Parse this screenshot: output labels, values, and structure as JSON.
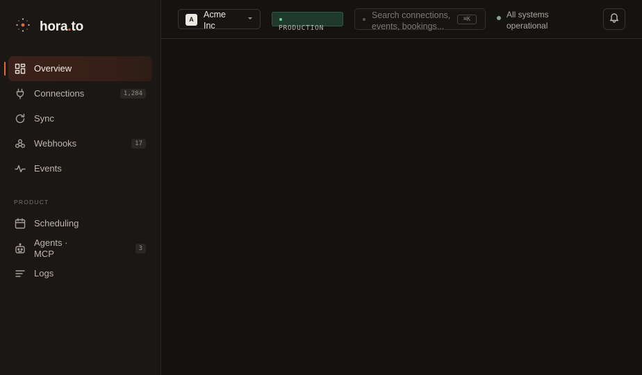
{
  "brand": {
    "name_prefix": "hora",
    "name_dot": ".",
    "name_suffix": "to",
    "accent": "#e0683f",
    "icon": "constellation-logo-icon"
  },
  "sidebar": {
    "main_items": [
      {
        "label": "Overview",
        "icon": "grid-icon",
        "active": true,
        "badge": ""
      },
      {
        "label": "Connections",
        "icon": "plug-icon",
        "active": false,
        "badge": "1,284"
      },
      {
        "label": "Sync",
        "icon": "refresh-icon",
        "active": false,
        "badge": ""
      },
      {
        "label": "Webhooks",
        "icon": "link-icon",
        "active": false,
        "badge": "17"
      },
      {
        "label": "Events",
        "icon": "pulse-icon",
        "active": false,
        "badge": ""
      }
    ],
    "section_label": "PRODUCT",
    "product_items": [
      {
        "label": "Scheduling",
        "icon": "calendar-icon",
        "badge": ""
      },
      {
        "label": "Agents · MCP",
        "icon": "robot-icon",
        "badge": "3"
      },
      {
        "label": "Logs",
        "icon": "lines-icon",
        "badge": ""
      }
    ]
  },
  "topbar": {
    "org": {
      "initial": "A",
      "name": "Acme Inc"
    },
    "environment": {
      "label": "PRODUCTION",
      "color": "#1f3a2c"
    },
    "search": {
      "placeholder": "Search connections, events, bookings...",
      "shortcut": "⌘K"
    },
    "status": {
      "text": "All systems operational",
      "color": "#87a290"
    },
    "notifications_icon": "bell-icon"
  }
}
